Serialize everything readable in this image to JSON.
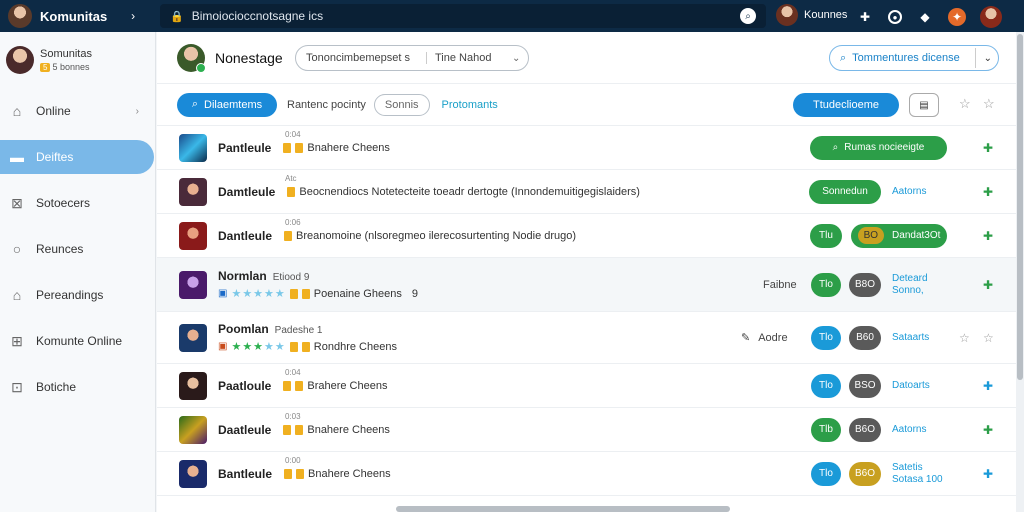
{
  "topbar": {
    "title": "Komunitas",
    "url": "Bimoiocioccnotsagne ics",
    "user_name": "Kounnes"
  },
  "sidebar": {
    "profile_name": "Somunitas",
    "profile_badge": "5",
    "profile_sub": "5 bonnes",
    "items": [
      {
        "label": "Online",
        "icon": "home-outline-icon",
        "glyph": "⌂"
      },
      {
        "label": "Deiftes",
        "icon": "card-icon",
        "glyph": "▬"
      },
      {
        "label": "Sotoecers",
        "icon": "store-icon",
        "glyph": "⊠"
      },
      {
        "label": "Reunces",
        "icon": "circle-icon",
        "glyph": "○"
      },
      {
        "label": "Pereandings",
        "icon": "house-icon",
        "glyph": "⌂"
      },
      {
        "label": "Komunte Online",
        "icon": "grid-icon",
        "glyph": "⊞"
      },
      {
        "label": "Botiche",
        "icon": "store-icon",
        "glyph": "⊡"
      }
    ]
  },
  "header": {
    "title": "Nonestage",
    "select1_value": "Tononcimbemepset s",
    "select1_extra": "Tine Nahod",
    "right_select": "Tommentures dicense"
  },
  "filters": {
    "primary": "Dilaemtems",
    "label": "Rantenc pocinty",
    "pill": "Sonnis",
    "link": "Protomants",
    "right_button": "Ttudeclioeme"
  },
  "rows": [
    {
      "name": "Pantleule",
      "meta": "0:04",
      "desc": "Bnahere Cheens",
      "pill1": "Rumas nocieeigte"
    },
    {
      "name": "Damtleule",
      "meta": "Atc",
      "desc": "Beocnendiocs Notetecteite toeadr dertogte (Innondemuitigegislaiders)",
      "pill1": "Sonnedun",
      "link": "Aatorns"
    },
    {
      "name": "Dantleule",
      "meta": "0:06",
      "desc": "Breanomoine (nlsoregmeo ilerecosurtenting Nodie drugo)",
      "pill1": "Tlu",
      "pill2": "Dandat3Ot"
    },
    {
      "name": "Normlan",
      "meta_inline": "Etiood 9",
      "desc": "Poenaine Gheens",
      "desc_num": "9",
      "tl": "Faibne",
      "pill1": "Tlo",
      "pill2": "B8O",
      "link": "Deteard Sonno,"
    },
    {
      "name": "Poomlan",
      "meta_inline": "Padeshe 1",
      "desc": "Rondhre Cheens",
      "tl": "Aodre",
      "pill1": "Tlo",
      "pill2": "B60",
      "link": "Sataarts"
    },
    {
      "name": "Paatloule",
      "meta": "0:04",
      "desc": "Brahere Cheens",
      "pill1": "Tlo",
      "pill2": "BSO",
      "link": "Datoarts"
    },
    {
      "name": "Daatleule",
      "meta": "0:03",
      "desc": "Bnahere Cheens",
      "pill1": "Tlb",
      "pill2": "B6O",
      "link": "Aatorns"
    },
    {
      "name": "Bantleule",
      "meta": "0:00",
      "desc": "Bnahere Cheens",
      "pill1": "Tlo",
      "pill2": "B6O",
      "link": "Satetis Sotasa 100"
    }
  ]
}
